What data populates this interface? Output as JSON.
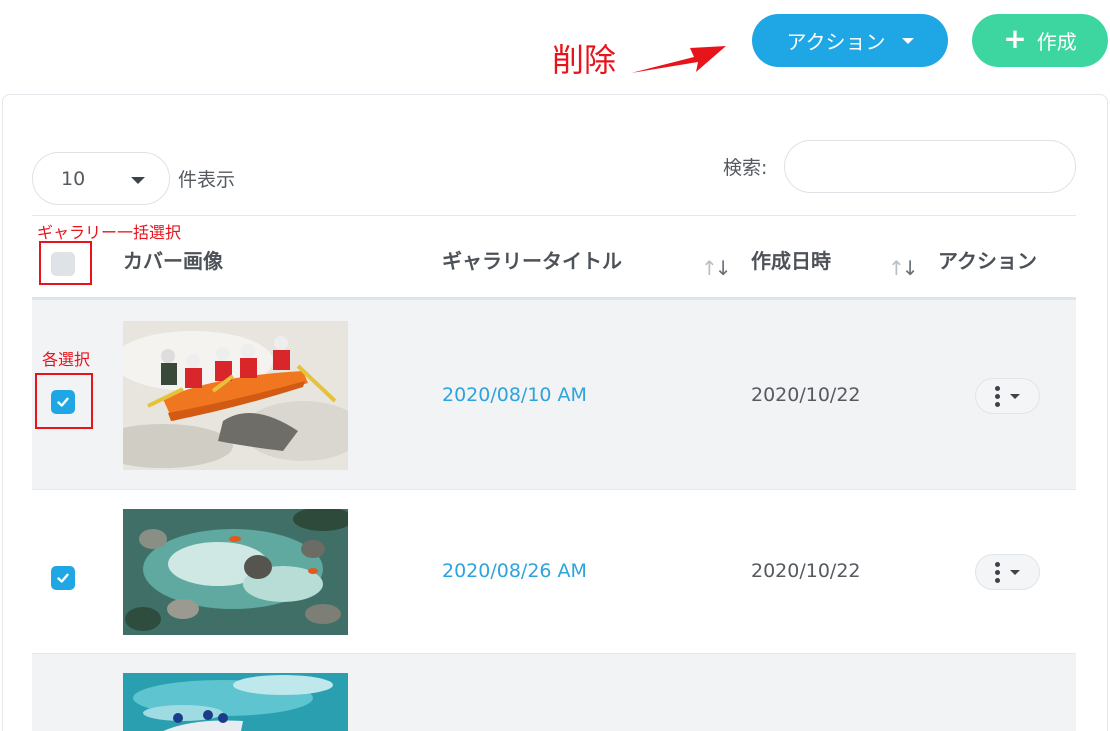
{
  "toolbar": {
    "action_button_label": "アクション",
    "create_button_label": "作成",
    "create_button_icon": "plus-icon"
  },
  "annotations": {
    "delete_note": "削除",
    "select_all_note": "ギャラリー一括選択",
    "select_each_note": "各選択",
    "color": "#e8141c"
  },
  "table_controls": {
    "page_length_value": "10",
    "page_length_suffix": "件表示",
    "search_label": "検索:",
    "search_value": ""
  },
  "table": {
    "headers": {
      "cover_image": "カバー画像",
      "gallery_title": "ギャラリータイトル",
      "created_date": "作成日時",
      "action": "アクション"
    },
    "select_all_checked": false,
    "rows": [
      {
        "checked": true,
        "image": "rafting-photo-1",
        "title": "2020/08/10 AM",
        "created": "2020/10/22"
      },
      {
        "checked": true,
        "image": "rafting-photo-2",
        "title": "2020/08/26 AM",
        "created": "2020/10/22"
      },
      {
        "checked": false,
        "image": "rafting-photo-3",
        "title": "",
        "created": ""
      }
    ]
  },
  "colors": {
    "primary": "#1fa6e4",
    "create": "#3dd6a0",
    "link": "#2ea3dc",
    "row_highlight": "#f2f3f5"
  }
}
